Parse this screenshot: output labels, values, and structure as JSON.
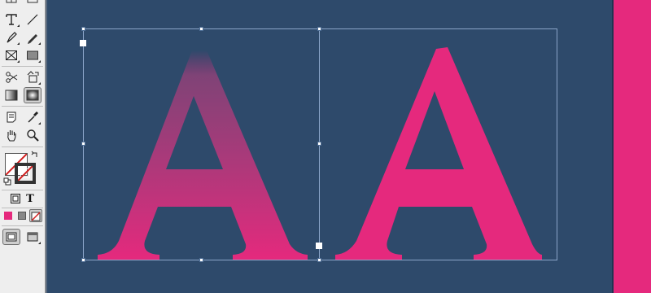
{
  "toolbox": {
    "rows": [
      {
        "left": "table-icon",
        "right": "table2-icon"
      },
      {
        "left": "type-tool-icon",
        "right": "line-tool-icon"
      },
      {
        "left": "pen-tool-icon",
        "right": "pencil-tool-icon"
      },
      {
        "left": "rectangle-frame-tool-icon",
        "right": "rectangle-tool-icon"
      },
      {
        "left": "scissors-tool-icon",
        "right": "free-transform-tool-icon"
      },
      {
        "left": "gradient-swatch-tool-icon",
        "right": "gradient-feather-tool-icon"
      },
      {
        "left": "note-tool-icon",
        "right": "eyedropper-tool-icon"
      },
      {
        "left": "hand-tool-icon",
        "right": "zoom-tool-icon"
      }
    ],
    "active_tool": "gradient-feather-tool-icon",
    "format_text_label": "T",
    "fill_color": "#ffffff",
    "stroke_color": "none",
    "apply_color": "#e5297d",
    "apply_gradient": "#7a7a7a"
  },
  "canvas": {
    "background": "#2e4a6b",
    "letters": [
      "A",
      "A"
    ],
    "left_letter_gradient": {
      "top": "#2e4a6b",
      "bottom": "#e5297d"
    },
    "right_letter_color": "#e5297d",
    "side_panel_color": "#e5297d",
    "selection_color": "#8aa4c8"
  }
}
